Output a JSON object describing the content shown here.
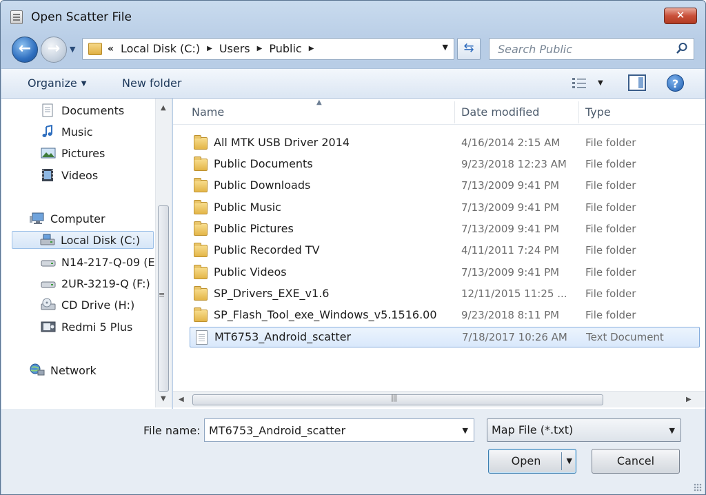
{
  "window": {
    "title": "Open Scatter File",
    "close_label": "✕"
  },
  "address": {
    "lead": "«",
    "crumbs": [
      "Local Disk (C:)",
      "Users",
      "Public"
    ]
  },
  "search": {
    "placeholder": "Search Public"
  },
  "toolbar": {
    "organize_label": "Organize",
    "new_folder_label": "New folder"
  },
  "help_label": "?",
  "nav_pane": {
    "items": [
      {
        "label": "Documents",
        "icon": "documents-icon"
      },
      {
        "label": "Music",
        "icon": "music-icon"
      },
      {
        "label": "Pictures",
        "icon": "pictures-icon"
      },
      {
        "label": "Videos",
        "icon": "videos-icon"
      },
      {
        "label": "Computer",
        "icon": "computer-icon"
      },
      {
        "label": "Local Disk (C:)",
        "icon": "local-disk-icon",
        "selected": true
      },
      {
        "label": "N14-217-Q-09 (E",
        "icon": "drive-icon"
      },
      {
        "label": "2UR-3219-Q (F:)",
        "icon": "drive-icon"
      },
      {
        "label": "CD Drive (H:)",
        "icon": "cd-drive-icon"
      },
      {
        "label": "Redmi 5 Plus",
        "icon": "phone-icon"
      },
      {
        "label": "Network",
        "icon": "network-icon"
      }
    ]
  },
  "columns": {
    "name": "Name",
    "date": "Date modified",
    "type": "Type"
  },
  "files": [
    {
      "name": "All MTK USB Driver 2014",
      "date": "4/16/2014 2:15 AM",
      "type": "File folder",
      "kind": "folder"
    },
    {
      "name": "Public Documents",
      "date": "9/23/2018 12:23 AM",
      "type": "File folder",
      "kind": "folder"
    },
    {
      "name": "Public Downloads",
      "date": "7/13/2009 9:41 PM",
      "type": "File folder",
      "kind": "folder"
    },
    {
      "name": "Public Music",
      "date": "7/13/2009 9:41 PM",
      "type": "File folder",
      "kind": "folder"
    },
    {
      "name": "Public Pictures",
      "date": "7/13/2009 9:41 PM",
      "type": "File folder",
      "kind": "folder"
    },
    {
      "name": "Public Recorded TV",
      "date": "4/11/2011 7:24 PM",
      "type": "File folder",
      "kind": "folder"
    },
    {
      "name": "Public Videos",
      "date": "7/13/2009 9:41 PM",
      "type": "File folder",
      "kind": "folder"
    },
    {
      "name": "SP_Drivers_EXE_v1.6",
      "date": "12/11/2015 11:25 ...",
      "type": "File folder",
      "kind": "folder"
    },
    {
      "name": "SP_Flash_Tool_exe_Windows_v5.1516.00",
      "date": "9/23/2018 8:11 PM",
      "type": "File folder",
      "kind": "folder"
    },
    {
      "name": "MT6753_Android_scatter",
      "date": "7/18/2017 10:26 AM",
      "type": "Text Document",
      "kind": "document",
      "selected": true
    }
  ],
  "file_name": {
    "label": "File name:",
    "value": "MT6753_Android_scatter"
  },
  "file_type": {
    "selected": "Map File (*.txt)"
  },
  "buttons": {
    "open": "Open",
    "cancel": "Cancel"
  },
  "colors": {
    "selection": "#d9e8fb",
    "accent": "#2f6fbf",
    "close": "#c9503a"
  }
}
